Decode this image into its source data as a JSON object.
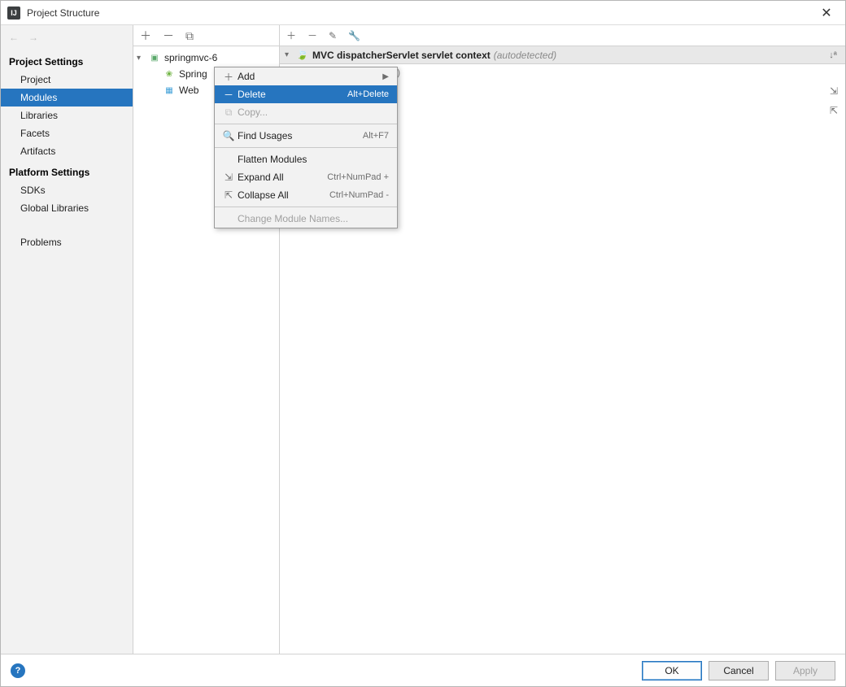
{
  "titlebar": {
    "app_icon": "IJ",
    "title": "Project Structure"
  },
  "sidebar": {
    "section1": "Project Settings",
    "items1": [
      {
        "label": "Project"
      },
      {
        "label": "Modules",
        "selected": true
      },
      {
        "label": "Libraries"
      },
      {
        "label": "Facets"
      },
      {
        "label": "Artifacts"
      }
    ],
    "section2": "Platform Settings",
    "items2": [
      {
        "label": "SDKs"
      },
      {
        "label": "Global Libraries"
      }
    ],
    "extra": [
      {
        "label": "Problems"
      }
    ]
  },
  "tree": {
    "root": "springmvc-6",
    "children": [
      {
        "label": "Spring",
        "icon": "spring"
      },
      {
        "label": "Web",
        "icon": "web"
      }
    ]
  },
  "detail": {
    "title": "MVC dispatcherServlet servlet context",
    "title_muted": "(autodetected)",
    "sub": "(src/springmvc.xml)"
  },
  "context_menu": [
    {
      "icon": "＋",
      "label": "Add",
      "sub": "▶"
    },
    {
      "icon": "－",
      "label": "Delete",
      "shortcut": "Alt+Delete",
      "selected": true
    },
    {
      "icon": "⧉",
      "label": "Copy...",
      "disabled": true
    },
    {
      "sep": true
    },
    {
      "icon": "🔍",
      "label": "Find Usages",
      "shortcut": "Alt+F7"
    },
    {
      "sep": true
    },
    {
      "icon": "",
      "label": "Flatten Modules"
    },
    {
      "icon": "⇲",
      "label": "Expand All",
      "shortcut": "Ctrl+NumPad +"
    },
    {
      "icon": "⇱",
      "label": "Collapse All",
      "shortcut": "Ctrl+NumPad -"
    },
    {
      "sep": true
    },
    {
      "icon": "",
      "label": "Change Module Names...",
      "disabled": true
    }
  ],
  "footer": {
    "ok": "OK",
    "cancel": "Cancel",
    "apply": "Apply"
  }
}
